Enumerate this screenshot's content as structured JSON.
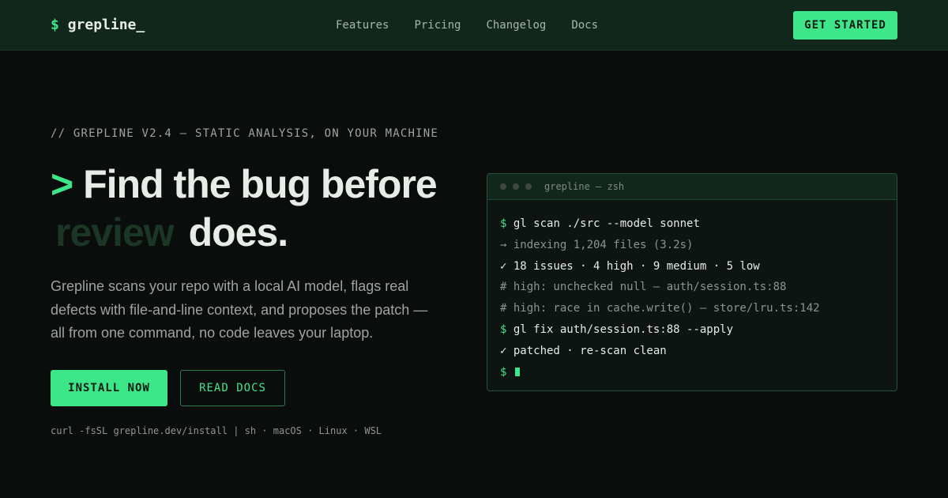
{
  "brand": {
    "prompt": "$",
    "name": "grepline_"
  },
  "nav": {
    "links": [
      "Features",
      "Pricing",
      "Changelog",
      "Docs"
    ],
    "cta_label": "GET STARTED"
  },
  "hero": {
    "eyebrow": "// GREPLINE V2.4 — STATIC ANALYSIS, ON YOUR MACHINE",
    "headline_prompt": ">",
    "headline_line1": "Find the bug before",
    "headline_dim": "review",
    "headline_end": "does.",
    "description": "Grepline scans your repo with a local AI model, flags real defects with file-and-line context, and proposes the patch — all from one command, no code leaves your laptop.",
    "primary_button": "INSTALL NOW",
    "secondary_button": "READ DOCS",
    "install_note": "curl -fsSL grepline.dev/install | sh · macOS · Linux · WSL"
  },
  "terminal": {
    "title": "grepline — zsh",
    "prompt_symbol": "$",
    "lines": [
      {
        "kind": "cmd",
        "text": "gl scan ./src --model sonnet"
      },
      {
        "kind": "muted",
        "text": "→ indexing 1,204 files (3.2s)"
      },
      {
        "kind": "ok",
        "text": "✓ 18 issues · 4 high · 9 medium · 5 low"
      },
      {
        "kind": "comment",
        "text": "# high: unchecked null — auth/session.ts:88"
      },
      {
        "kind": "comment",
        "text": "# high: race in cache.write() — store/lru.ts:142"
      },
      {
        "kind": "cmd",
        "text": "gl fix auth/session.ts:88 --apply"
      },
      {
        "kind": "ok",
        "text": "✓ patched · re-scan clean"
      }
    ]
  },
  "colors": {
    "accent": "#3ee68a",
    "background": "#0a0d0c",
    "nav_background": "#12271c",
    "headline_dim": "#1b3526"
  },
  "icons": [
    "window-dot-icon",
    "terminal-cursor-icon"
  ]
}
